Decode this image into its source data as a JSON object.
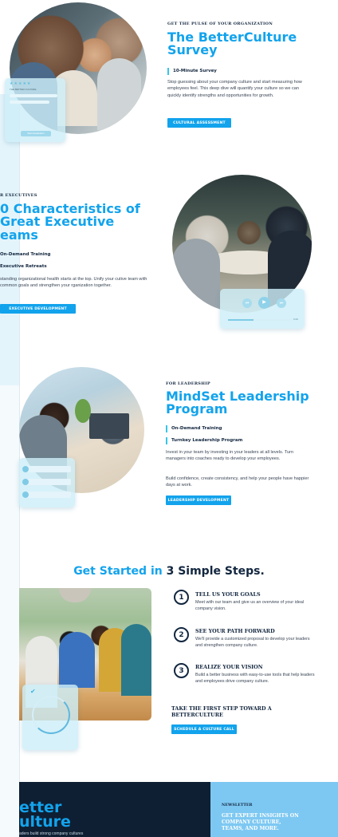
{
  "survey": {
    "eyebrow": "GET THE PULSE OF YOUR ORGANIZATION",
    "title_line1": "The BetterCulture",
    "title_line2": "Survey",
    "pill": "10-Minute Survey",
    "body": "Stop guessing about your company culture and start measuring how employees feel. This deep dive will quantify your culture so we can quickly identify strengths and opportunities for growth.",
    "button": "CULTURAL ASSESSMENT",
    "card_line": "THE BETTER CULTURE",
    "card_button": "Start Evaluation"
  },
  "executives": {
    "eyebrow": "R EXECUTIVES",
    "title_line1": "0 Characteristics of",
    "title_line2": "Great Executive",
    "title_line3": "eams",
    "pill1": "On-Demand Training",
    "pill2": "Executive Retreats",
    "body": "standing organizational health starts at the top. Unify your cutive team with common goals and strengthen your rganization together.",
    "button": "EXECUTIVE DEVELOPMENT",
    "player_time": "0:43"
  },
  "leadership": {
    "eyebrow": "FOR LEADERSHIP",
    "title_line1": "MindSet Leadership",
    "title_line2": "Program",
    "pill1": "On-Demand Training",
    "pill2": "Turnkey Leadership Program",
    "body1": "Invest in your team by investing in your leaders at all levels. Turn managers into coaches ready to develop your employees.",
    "body2": "Build confidence, create consistency, and help your people have happier days at work.",
    "button": "LEADERSHIP DEVELOPMENT"
  },
  "steps": {
    "heading_light": "Get Started in",
    "heading_dark": "3 Simple Steps.",
    "items": [
      {
        "num": "1",
        "title": "TELL US YOUR GOALS",
        "desc": "Meet with our team and give us an overview of your ideal company vision."
      },
      {
        "num": "2",
        "title": "SEE YOUR PATH FORWARD",
        "desc": "We'll provide a customized proposal to develop your leaders and strengthen company culture."
      },
      {
        "num": "3",
        "title": "REALIZE YOUR VISION",
        "desc": "Build a better business with easy-to-use tools that help leaders and employees drive company culture."
      }
    ],
    "cta_title_line1": "TAKE THE FIRST STEP TOWARD A",
    "cta_title_line2": "BETTERCULTURE",
    "cta_button": "SCHEDULE A CULTURE CALL"
  },
  "footer": {
    "logo_line1": "etter",
    "logo_line2": "ulture",
    "tagline": "aders build strong company cultures",
    "newsletter_label": "NEWSLETTER",
    "newsletter_line1": "GET EXPERT INSIGHTS ON",
    "newsletter_line2": "COMPANY CULTURE,",
    "newsletter_line3": "TEAMS, AND MORE."
  },
  "colors": {
    "accent": "#12a3ec",
    "navy": "#12263f",
    "footer_dark": "#0e1f33",
    "footer_light": "#7dc8f2"
  }
}
